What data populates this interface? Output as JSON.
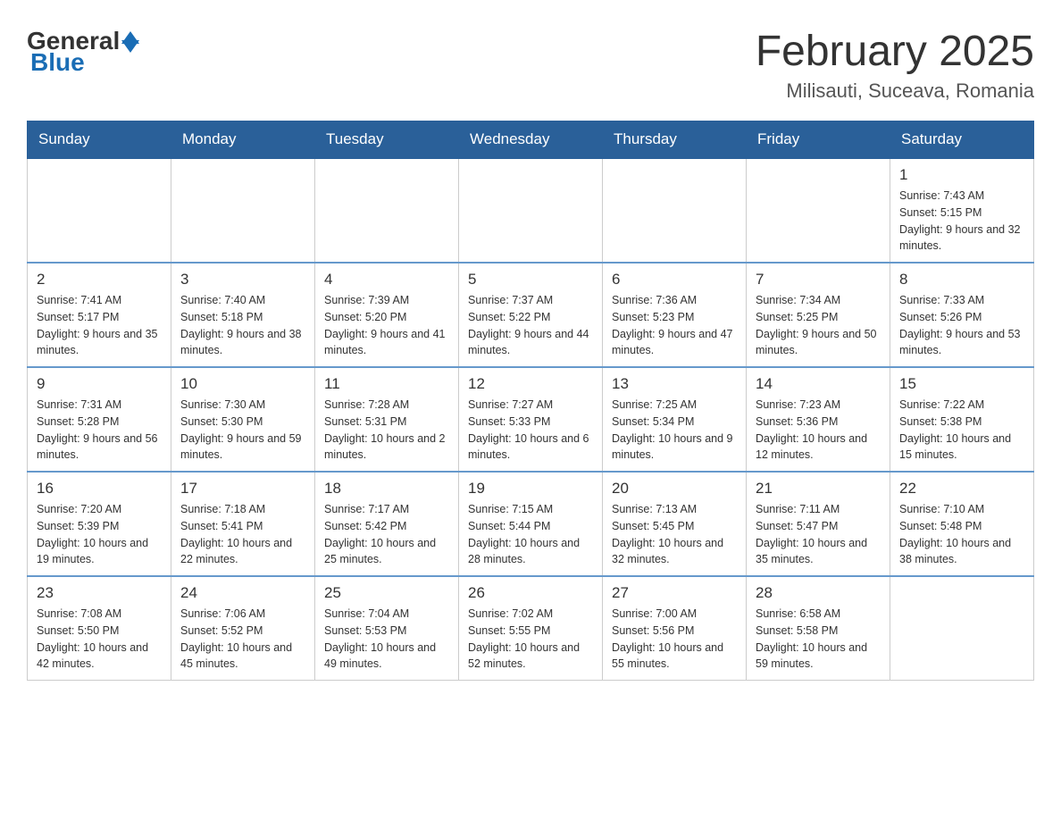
{
  "header": {
    "logo_general": "General",
    "logo_blue": "Blue",
    "month_title": "February 2025",
    "location": "Milisauti, Suceava, Romania"
  },
  "weekdays": [
    "Sunday",
    "Monday",
    "Tuesday",
    "Wednesday",
    "Thursday",
    "Friday",
    "Saturday"
  ],
  "weeks": [
    [
      null,
      null,
      null,
      null,
      null,
      null,
      {
        "day": "1",
        "sunrise": "Sunrise: 7:43 AM",
        "sunset": "Sunset: 5:15 PM",
        "daylight": "Daylight: 9 hours and 32 minutes."
      }
    ],
    [
      {
        "day": "2",
        "sunrise": "Sunrise: 7:41 AM",
        "sunset": "Sunset: 5:17 PM",
        "daylight": "Daylight: 9 hours and 35 minutes."
      },
      {
        "day": "3",
        "sunrise": "Sunrise: 7:40 AM",
        "sunset": "Sunset: 5:18 PM",
        "daylight": "Daylight: 9 hours and 38 minutes."
      },
      {
        "day": "4",
        "sunrise": "Sunrise: 7:39 AM",
        "sunset": "Sunset: 5:20 PM",
        "daylight": "Daylight: 9 hours and 41 minutes."
      },
      {
        "day": "5",
        "sunrise": "Sunrise: 7:37 AM",
        "sunset": "Sunset: 5:22 PM",
        "daylight": "Daylight: 9 hours and 44 minutes."
      },
      {
        "day": "6",
        "sunrise": "Sunrise: 7:36 AM",
        "sunset": "Sunset: 5:23 PM",
        "daylight": "Daylight: 9 hours and 47 minutes."
      },
      {
        "day": "7",
        "sunrise": "Sunrise: 7:34 AM",
        "sunset": "Sunset: 5:25 PM",
        "daylight": "Daylight: 9 hours and 50 minutes."
      },
      {
        "day": "8",
        "sunrise": "Sunrise: 7:33 AM",
        "sunset": "Sunset: 5:26 PM",
        "daylight": "Daylight: 9 hours and 53 minutes."
      }
    ],
    [
      {
        "day": "9",
        "sunrise": "Sunrise: 7:31 AM",
        "sunset": "Sunset: 5:28 PM",
        "daylight": "Daylight: 9 hours and 56 minutes."
      },
      {
        "day": "10",
        "sunrise": "Sunrise: 7:30 AM",
        "sunset": "Sunset: 5:30 PM",
        "daylight": "Daylight: 9 hours and 59 minutes."
      },
      {
        "day": "11",
        "sunrise": "Sunrise: 7:28 AM",
        "sunset": "Sunset: 5:31 PM",
        "daylight": "Daylight: 10 hours and 2 minutes."
      },
      {
        "day": "12",
        "sunrise": "Sunrise: 7:27 AM",
        "sunset": "Sunset: 5:33 PM",
        "daylight": "Daylight: 10 hours and 6 minutes."
      },
      {
        "day": "13",
        "sunrise": "Sunrise: 7:25 AM",
        "sunset": "Sunset: 5:34 PM",
        "daylight": "Daylight: 10 hours and 9 minutes."
      },
      {
        "day": "14",
        "sunrise": "Sunrise: 7:23 AM",
        "sunset": "Sunset: 5:36 PM",
        "daylight": "Daylight: 10 hours and 12 minutes."
      },
      {
        "day": "15",
        "sunrise": "Sunrise: 7:22 AM",
        "sunset": "Sunset: 5:38 PM",
        "daylight": "Daylight: 10 hours and 15 minutes."
      }
    ],
    [
      {
        "day": "16",
        "sunrise": "Sunrise: 7:20 AM",
        "sunset": "Sunset: 5:39 PM",
        "daylight": "Daylight: 10 hours and 19 minutes."
      },
      {
        "day": "17",
        "sunrise": "Sunrise: 7:18 AM",
        "sunset": "Sunset: 5:41 PM",
        "daylight": "Daylight: 10 hours and 22 minutes."
      },
      {
        "day": "18",
        "sunrise": "Sunrise: 7:17 AM",
        "sunset": "Sunset: 5:42 PM",
        "daylight": "Daylight: 10 hours and 25 minutes."
      },
      {
        "day": "19",
        "sunrise": "Sunrise: 7:15 AM",
        "sunset": "Sunset: 5:44 PM",
        "daylight": "Daylight: 10 hours and 28 minutes."
      },
      {
        "day": "20",
        "sunrise": "Sunrise: 7:13 AM",
        "sunset": "Sunset: 5:45 PM",
        "daylight": "Daylight: 10 hours and 32 minutes."
      },
      {
        "day": "21",
        "sunrise": "Sunrise: 7:11 AM",
        "sunset": "Sunset: 5:47 PM",
        "daylight": "Daylight: 10 hours and 35 minutes."
      },
      {
        "day": "22",
        "sunrise": "Sunrise: 7:10 AM",
        "sunset": "Sunset: 5:48 PM",
        "daylight": "Daylight: 10 hours and 38 minutes."
      }
    ],
    [
      {
        "day": "23",
        "sunrise": "Sunrise: 7:08 AM",
        "sunset": "Sunset: 5:50 PM",
        "daylight": "Daylight: 10 hours and 42 minutes."
      },
      {
        "day": "24",
        "sunrise": "Sunrise: 7:06 AM",
        "sunset": "Sunset: 5:52 PM",
        "daylight": "Daylight: 10 hours and 45 minutes."
      },
      {
        "day": "25",
        "sunrise": "Sunrise: 7:04 AM",
        "sunset": "Sunset: 5:53 PM",
        "daylight": "Daylight: 10 hours and 49 minutes."
      },
      {
        "day": "26",
        "sunrise": "Sunrise: 7:02 AM",
        "sunset": "Sunset: 5:55 PM",
        "daylight": "Daylight: 10 hours and 52 minutes."
      },
      {
        "day": "27",
        "sunrise": "Sunrise: 7:00 AM",
        "sunset": "Sunset: 5:56 PM",
        "daylight": "Daylight: 10 hours and 55 minutes."
      },
      {
        "day": "28",
        "sunrise": "Sunrise: 6:58 AM",
        "sunset": "Sunset: 5:58 PM",
        "daylight": "Daylight: 10 hours and 59 minutes."
      },
      null
    ]
  ]
}
